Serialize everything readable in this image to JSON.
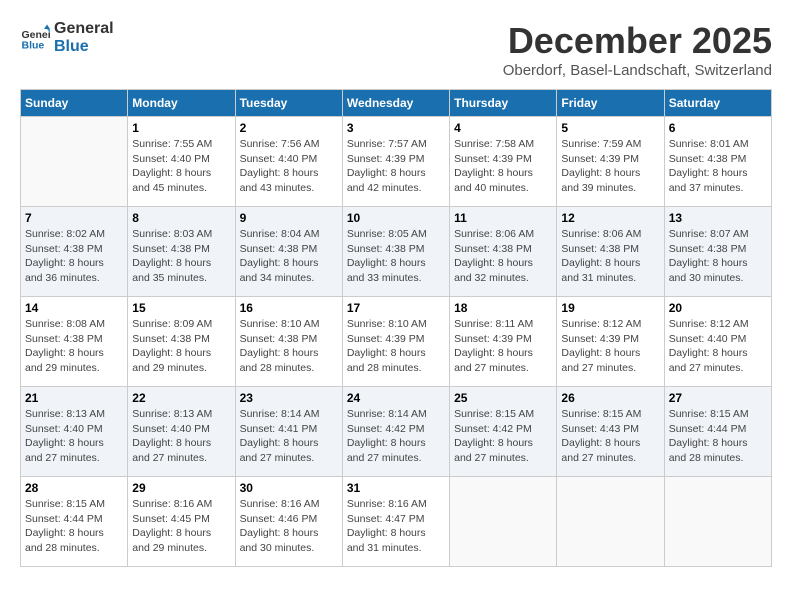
{
  "header": {
    "logo_line1": "General",
    "logo_line2": "Blue",
    "month": "December 2025",
    "location": "Oberdorf, Basel-Landschaft, Switzerland"
  },
  "weekdays": [
    "Sunday",
    "Monday",
    "Tuesday",
    "Wednesday",
    "Thursday",
    "Friday",
    "Saturday"
  ],
  "weeks": [
    [
      {
        "day": "",
        "info": ""
      },
      {
        "day": "1",
        "info": "Sunrise: 7:55 AM\nSunset: 4:40 PM\nDaylight: 8 hours\nand 45 minutes."
      },
      {
        "day": "2",
        "info": "Sunrise: 7:56 AM\nSunset: 4:40 PM\nDaylight: 8 hours\nand 43 minutes."
      },
      {
        "day": "3",
        "info": "Sunrise: 7:57 AM\nSunset: 4:39 PM\nDaylight: 8 hours\nand 42 minutes."
      },
      {
        "day": "4",
        "info": "Sunrise: 7:58 AM\nSunset: 4:39 PM\nDaylight: 8 hours\nand 40 minutes."
      },
      {
        "day": "5",
        "info": "Sunrise: 7:59 AM\nSunset: 4:39 PM\nDaylight: 8 hours\nand 39 minutes."
      },
      {
        "day": "6",
        "info": "Sunrise: 8:01 AM\nSunset: 4:38 PM\nDaylight: 8 hours\nand 37 minutes."
      }
    ],
    [
      {
        "day": "7",
        "info": "Sunrise: 8:02 AM\nSunset: 4:38 PM\nDaylight: 8 hours\nand 36 minutes."
      },
      {
        "day": "8",
        "info": "Sunrise: 8:03 AM\nSunset: 4:38 PM\nDaylight: 8 hours\nand 35 minutes."
      },
      {
        "day": "9",
        "info": "Sunrise: 8:04 AM\nSunset: 4:38 PM\nDaylight: 8 hours\nand 34 minutes."
      },
      {
        "day": "10",
        "info": "Sunrise: 8:05 AM\nSunset: 4:38 PM\nDaylight: 8 hours\nand 33 minutes."
      },
      {
        "day": "11",
        "info": "Sunrise: 8:06 AM\nSunset: 4:38 PM\nDaylight: 8 hours\nand 32 minutes."
      },
      {
        "day": "12",
        "info": "Sunrise: 8:06 AM\nSunset: 4:38 PM\nDaylight: 8 hours\nand 31 minutes."
      },
      {
        "day": "13",
        "info": "Sunrise: 8:07 AM\nSunset: 4:38 PM\nDaylight: 8 hours\nand 30 minutes."
      }
    ],
    [
      {
        "day": "14",
        "info": "Sunrise: 8:08 AM\nSunset: 4:38 PM\nDaylight: 8 hours\nand 29 minutes."
      },
      {
        "day": "15",
        "info": "Sunrise: 8:09 AM\nSunset: 4:38 PM\nDaylight: 8 hours\nand 29 minutes."
      },
      {
        "day": "16",
        "info": "Sunrise: 8:10 AM\nSunset: 4:38 PM\nDaylight: 8 hours\nand 28 minutes."
      },
      {
        "day": "17",
        "info": "Sunrise: 8:10 AM\nSunset: 4:39 PM\nDaylight: 8 hours\nand 28 minutes."
      },
      {
        "day": "18",
        "info": "Sunrise: 8:11 AM\nSunset: 4:39 PM\nDaylight: 8 hours\nand 27 minutes."
      },
      {
        "day": "19",
        "info": "Sunrise: 8:12 AM\nSunset: 4:39 PM\nDaylight: 8 hours\nand 27 minutes."
      },
      {
        "day": "20",
        "info": "Sunrise: 8:12 AM\nSunset: 4:40 PM\nDaylight: 8 hours\nand 27 minutes."
      }
    ],
    [
      {
        "day": "21",
        "info": "Sunrise: 8:13 AM\nSunset: 4:40 PM\nDaylight: 8 hours\nand 27 minutes."
      },
      {
        "day": "22",
        "info": "Sunrise: 8:13 AM\nSunset: 4:40 PM\nDaylight: 8 hours\nand 27 minutes."
      },
      {
        "day": "23",
        "info": "Sunrise: 8:14 AM\nSunset: 4:41 PM\nDaylight: 8 hours\nand 27 minutes."
      },
      {
        "day": "24",
        "info": "Sunrise: 8:14 AM\nSunset: 4:42 PM\nDaylight: 8 hours\nand 27 minutes."
      },
      {
        "day": "25",
        "info": "Sunrise: 8:15 AM\nSunset: 4:42 PM\nDaylight: 8 hours\nand 27 minutes."
      },
      {
        "day": "26",
        "info": "Sunrise: 8:15 AM\nSunset: 4:43 PM\nDaylight: 8 hours\nand 27 minutes."
      },
      {
        "day": "27",
        "info": "Sunrise: 8:15 AM\nSunset: 4:44 PM\nDaylight: 8 hours\nand 28 minutes."
      }
    ],
    [
      {
        "day": "28",
        "info": "Sunrise: 8:15 AM\nSunset: 4:44 PM\nDaylight: 8 hours\nand 28 minutes."
      },
      {
        "day": "29",
        "info": "Sunrise: 8:16 AM\nSunset: 4:45 PM\nDaylight: 8 hours\nand 29 minutes."
      },
      {
        "day": "30",
        "info": "Sunrise: 8:16 AM\nSunset: 4:46 PM\nDaylight: 8 hours\nand 30 minutes."
      },
      {
        "day": "31",
        "info": "Sunrise: 8:16 AM\nSunset: 4:47 PM\nDaylight: 8 hours\nand 31 minutes."
      },
      {
        "day": "",
        "info": ""
      },
      {
        "day": "",
        "info": ""
      },
      {
        "day": "",
        "info": ""
      }
    ]
  ],
  "colors": {
    "header_bg": "#1a6faf",
    "header_text": "#ffffff",
    "accent": "#1a6faf"
  }
}
